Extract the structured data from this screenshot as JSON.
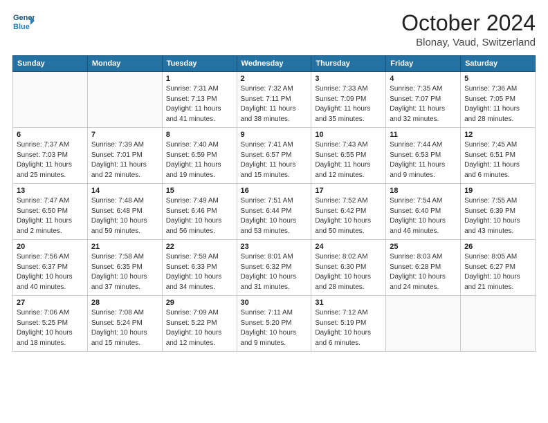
{
  "header": {
    "logo_line1": "General",
    "logo_line2": "Blue",
    "month_title": "October 2024",
    "location": "Blonay, Vaud, Switzerland"
  },
  "weekdays": [
    "Sunday",
    "Monday",
    "Tuesday",
    "Wednesday",
    "Thursday",
    "Friday",
    "Saturday"
  ],
  "weeks": [
    [
      {
        "date": "",
        "info": ""
      },
      {
        "date": "",
        "info": ""
      },
      {
        "date": "1",
        "info": "Sunrise: 7:31 AM\nSunset: 7:13 PM\nDaylight: 11 hours and 41 minutes."
      },
      {
        "date": "2",
        "info": "Sunrise: 7:32 AM\nSunset: 7:11 PM\nDaylight: 11 hours and 38 minutes."
      },
      {
        "date": "3",
        "info": "Sunrise: 7:33 AM\nSunset: 7:09 PM\nDaylight: 11 hours and 35 minutes."
      },
      {
        "date": "4",
        "info": "Sunrise: 7:35 AM\nSunset: 7:07 PM\nDaylight: 11 hours and 32 minutes."
      },
      {
        "date": "5",
        "info": "Sunrise: 7:36 AM\nSunset: 7:05 PM\nDaylight: 11 hours and 28 minutes."
      }
    ],
    [
      {
        "date": "6",
        "info": "Sunrise: 7:37 AM\nSunset: 7:03 PM\nDaylight: 11 hours and 25 minutes."
      },
      {
        "date": "7",
        "info": "Sunrise: 7:39 AM\nSunset: 7:01 PM\nDaylight: 11 hours and 22 minutes."
      },
      {
        "date": "8",
        "info": "Sunrise: 7:40 AM\nSunset: 6:59 PM\nDaylight: 11 hours and 19 minutes."
      },
      {
        "date": "9",
        "info": "Sunrise: 7:41 AM\nSunset: 6:57 PM\nDaylight: 11 hours and 15 minutes."
      },
      {
        "date": "10",
        "info": "Sunrise: 7:43 AM\nSunset: 6:55 PM\nDaylight: 11 hours and 12 minutes."
      },
      {
        "date": "11",
        "info": "Sunrise: 7:44 AM\nSunset: 6:53 PM\nDaylight: 11 hours and 9 minutes."
      },
      {
        "date": "12",
        "info": "Sunrise: 7:45 AM\nSunset: 6:51 PM\nDaylight: 11 hours and 6 minutes."
      }
    ],
    [
      {
        "date": "13",
        "info": "Sunrise: 7:47 AM\nSunset: 6:50 PM\nDaylight: 11 hours and 2 minutes."
      },
      {
        "date": "14",
        "info": "Sunrise: 7:48 AM\nSunset: 6:48 PM\nDaylight: 10 hours and 59 minutes."
      },
      {
        "date": "15",
        "info": "Sunrise: 7:49 AM\nSunset: 6:46 PM\nDaylight: 10 hours and 56 minutes."
      },
      {
        "date": "16",
        "info": "Sunrise: 7:51 AM\nSunset: 6:44 PM\nDaylight: 10 hours and 53 minutes."
      },
      {
        "date": "17",
        "info": "Sunrise: 7:52 AM\nSunset: 6:42 PM\nDaylight: 10 hours and 50 minutes."
      },
      {
        "date": "18",
        "info": "Sunrise: 7:54 AM\nSunset: 6:40 PM\nDaylight: 10 hours and 46 minutes."
      },
      {
        "date": "19",
        "info": "Sunrise: 7:55 AM\nSunset: 6:39 PM\nDaylight: 10 hours and 43 minutes."
      }
    ],
    [
      {
        "date": "20",
        "info": "Sunrise: 7:56 AM\nSunset: 6:37 PM\nDaylight: 10 hours and 40 minutes."
      },
      {
        "date": "21",
        "info": "Sunrise: 7:58 AM\nSunset: 6:35 PM\nDaylight: 10 hours and 37 minutes."
      },
      {
        "date": "22",
        "info": "Sunrise: 7:59 AM\nSunset: 6:33 PM\nDaylight: 10 hours and 34 minutes."
      },
      {
        "date": "23",
        "info": "Sunrise: 8:01 AM\nSunset: 6:32 PM\nDaylight: 10 hours and 31 minutes."
      },
      {
        "date": "24",
        "info": "Sunrise: 8:02 AM\nSunset: 6:30 PM\nDaylight: 10 hours and 28 minutes."
      },
      {
        "date": "25",
        "info": "Sunrise: 8:03 AM\nSunset: 6:28 PM\nDaylight: 10 hours and 24 minutes."
      },
      {
        "date": "26",
        "info": "Sunrise: 8:05 AM\nSunset: 6:27 PM\nDaylight: 10 hours and 21 minutes."
      }
    ],
    [
      {
        "date": "27",
        "info": "Sunrise: 7:06 AM\nSunset: 5:25 PM\nDaylight: 10 hours and 18 minutes."
      },
      {
        "date": "28",
        "info": "Sunrise: 7:08 AM\nSunset: 5:24 PM\nDaylight: 10 hours and 15 minutes."
      },
      {
        "date": "29",
        "info": "Sunrise: 7:09 AM\nSunset: 5:22 PM\nDaylight: 10 hours and 12 minutes."
      },
      {
        "date": "30",
        "info": "Sunrise: 7:11 AM\nSunset: 5:20 PM\nDaylight: 10 hours and 9 minutes."
      },
      {
        "date": "31",
        "info": "Sunrise: 7:12 AM\nSunset: 5:19 PM\nDaylight: 10 hours and 6 minutes."
      },
      {
        "date": "",
        "info": ""
      },
      {
        "date": "",
        "info": ""
      }
    ]
  ]
}
